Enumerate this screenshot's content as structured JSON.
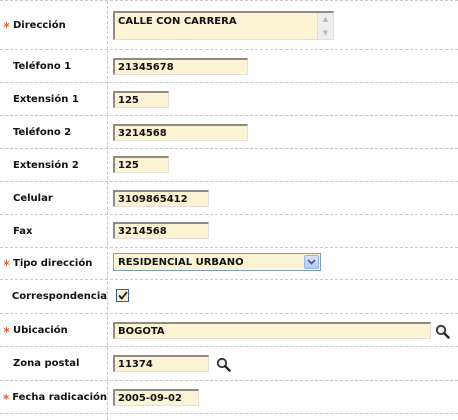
{
  "form": {
    "direccion": {
      "label": "Dirección",
      "required": "*",
      "value": "CALLE CON CARRERA"
    },
    "telefono1": {
      "label": "Teléfono 1",
      "value": "21345678"
    },
    "extension1": {
      "label": "Extensión 1",
      "value": "125"
    },
    "telefono2": {
      "label": "Teléfono 2",
      "value": "3214568"
    },
    "extension2": {
      "label": "Extensión 2",
      "value": "125"
    },
    "celular": {
      "label": "Celular",
      "value": "3109865412"
    },
    "fax": {
      "label": "Fax",
      "value": "3214568"
    },
    "tipo_direccion": {
      "label": "Tipo dirección",
      "required": "*",
      "value": "RESIDENCIAL URBANO"
    },
    "correspondencia": {
      "label": "Correspondencia",
      "checked": true
    },
    "ubicacion": {
      "label": "Ubicación",
      "required": "*",
      "value": "BOGOTA"
    },
    "zona_postal": {
      "label": "Zona postal",
      "value": "11374"
    },
    "fecha_radicacion": {
      "label": "Fecha radicación",
      "required": "*",
      "value": "2005-09-02"
    }
  },
  "colors": {
    "required_star": "#e8602c",
    "field_background": "#fdf4d6",
    "select_border": "#7f9db9"
  },
  "icons": {
    "lookup": "magnifier-icon",
    "checkmark": "checkmark-icon",
    "dropdown": "chevron-down-icon"
  }
}
